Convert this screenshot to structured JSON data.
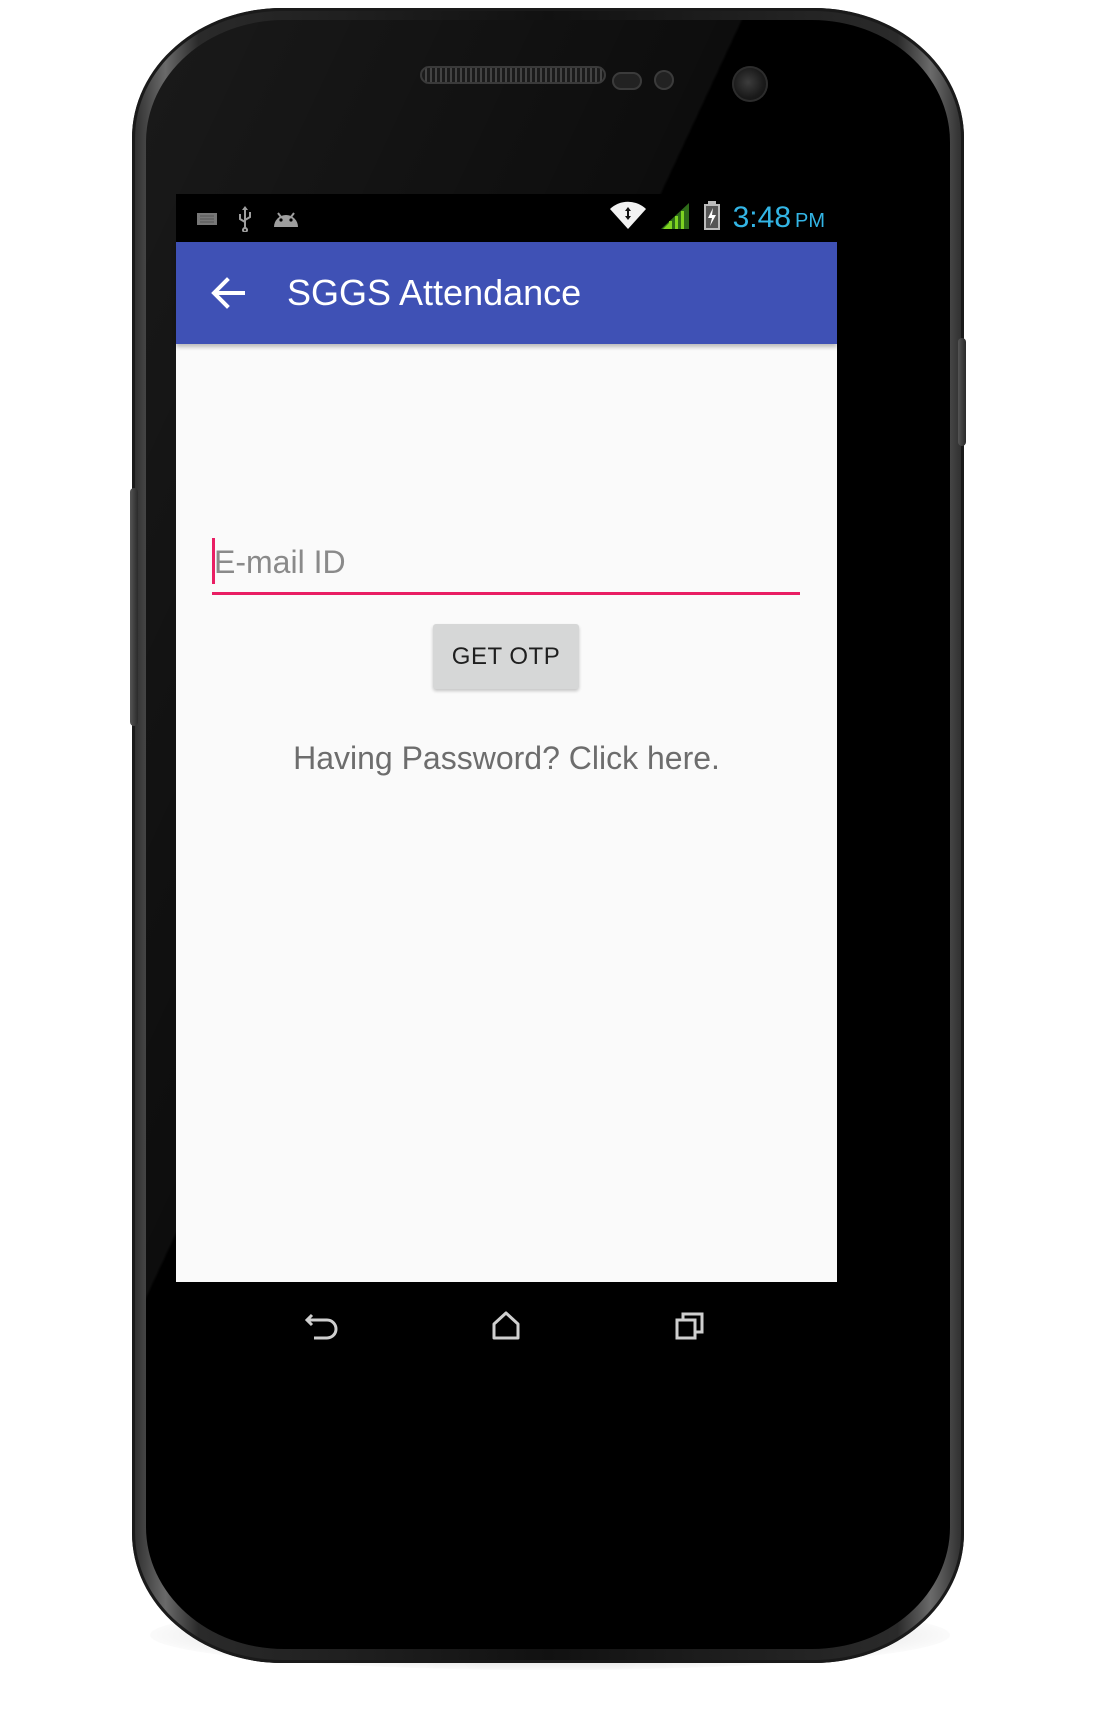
{
  "status_bar": {
    "left_icons": [
      "sim-card-icon",
      "usb-icon",
      "android-debug-icon"
    ],
    "right_icons": [
      "wifi-icon",
      "signal-icon",
      "battery-charging-icon"
    ],
    "time": "3:48",
    "ampm": "PM",
    "time_color": "#33b5e5"
  },
  "app_bar": {
    "title": "SGGS Attendance",
    "nav_icon": "arrow-back-icon",
    "color": "#3f51b5"
  },
  "form": {
    "email_placeholder": "E-mail ID",
    "email_value": "",
    "accent_color": "#e91e63",
    "otp_button_label": "GET OTP",
    "password_link": "Having Password? Click here."
  },
  "nav_bar": {
    "items": [
      "back-icon",
      "home-icon",
      "recents-icon"
    ]
  }
}
